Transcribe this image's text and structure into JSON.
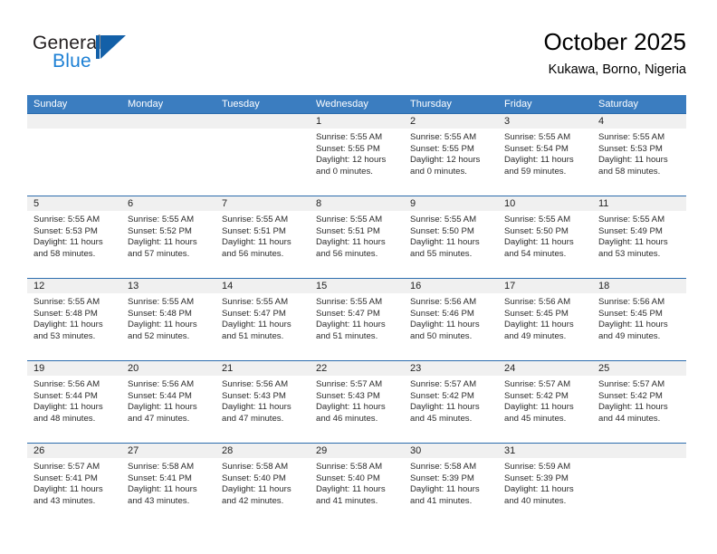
{
  "brand": {
    "name_part1": "General",
    "name_part2": "Blue"
  },
  "header": {
    "title": "October 2025",
    "location": "Kukawa, Borno, Nigeria"
  },
  "calendar": {
    "weekday_headers": [
      "Sunday",
      "Monday",
      "Tuesday",
      "Wednesday",
      "Thursday",
      "Friday",
      "Saturday"
    ],
    "accent_color": "#3b7dc0",
    "separator_color": "#2c6cad",
    "daynum_band_color": "#f0f0f0",
    "weeks": [
      [
        {
          "day": "",
          "sunrise": "",
          "sunset": "",
          "daylight_line1": "",
          "daylight_line2": ""
        },
        {
          "day": "",
          "sunrise": "",
          "sunset": "",
          "daylight_line1": "",
          "daylight_line2": ""
        },
        {
          "day": "",
          "sunrise": "",
          "sunset": "",
          "daylight_line1": "",
          "daylight_line2": ""
        },
        {
          "day": "1",
          "sunrise": "Sunrise: 5:55 AM",
          "sunset": "Sunset: 5:55 PM",
          "daylight_line1": "Daylight: 12 hours",
          "daylight_line2": "and 0 minutes."
        },
        {
          "day": "2",
          "sunrise": "Sunrise: 5:55 AM",
          "sunset": "Sunset: 5:55 PM",
          "daylight_line1": "Daylight: 12 hours",
          "daylight_line2": "and 0 minutes."
        },
        {
          "day": "3",
          "sunrise": "Sunrise: 5:55 AM",
          "sunset": "Sunset: 5:54 PM",
          "daylight_line1": "Daylight: 11 hours",
          "daylight_line2": "and 59 minutes."
        },
        {
          "day": "4",
          "sunrise": "Sunrise: 5:55 AM",
          "sunset": "Sunset: 5:53 PM",
          "daylight_line1": "Daylight: 11 hours",
          "daylight_line2": "and 58 minutes."
        }
      ],
      [
        {
          "day": "5",
          "sunrise": "Sunrise: 5:55 AM",
          "sunset": "Sunset: 5:53 PM",
          "daylight_line1": "Daylight: 11 hours",
          "daylight_line2": "and 58 minutes."
        },
        {
          "day": "6",
          "sunrise": "Sunrise: 5:55 AM",
          "sunset": "Sunset: 5:52 PM",
          "daylight_line1": "Daylight: 11 hours",
          "daylight_line2": "and 57 minutes."
        },
        {
          "day": "7",
          "sunrise": "Sunrise: 5:55 AM",
          "sunset": "Sunset: 5:51 PM",
          "daylight_line1": "Daylight: 11 hours",
          "daylight_line2": "and 56 minutes."
        },
        {
          "day": "8",
          "sunrise": "Sunrise: 5:55 AM",
          "sunset": "Sunset: 5:51 PM",
          "daylight_line1": "Daylight: 11 hours",
          "daylight_line2": "and 56 minutes."
        },
        {
          "day": "9",
          "sunrise": "Sunrise: 5:55 AM",
          "sunset": "Sunset: 5:50 PM",
          "daylight_line1": "Daylight: 11 hours",
          "daylight_line2": "and 55 minutes."
        },
        {
          "day": "10",
          "sunrise": "Sunrise: 5:55 AM",
          "sunset": "Sunset: 5:50 PM",
          "daylight_line1": "Daylight: 11 hours",
          "daylight_line2": "and 54 minutes."
        },
        {
          "day": "11",
          "sunrise": "Sunrise: 5:55 AM",
          "sunset": "Sunset: 5:49 PM",
          "daylight_line1": "Daylight: 11 hours",
          "daylight_line2": "and 53 minutes."
        }
      ],
      [
        {
          "day": "12",
          "sunrise": "Sunrise: 5:55 AM",
          "sunset": "Sunset: 5:48 PM",
          "daylight_line1": "Daylight: 11 hours",
          "daylight_line2": "and 53 minutes."
        },
        {
          "day": "13",
          "sunrise": "Sunrise: 5:55 AM",
          "sunset": "Sunset: 5:48 PM",
          "daylight_line1": "Daylight: 11 hours",
          "daylight_line2": "and 52 minutes."
        },
        {
          "day": "14",
          "sunrise": "Sunrise: 5:55 AM",
          "sunset": "Sunset: 5:47 PM",
          "daylight_line1": "Daylight: 11 hours",
          "daylight_line2": "and 51 minutes."
        },
        {
          "day": "15",
          "sunrise": "Sunrise: 5:55 AM",
          "sunset": "Sunset: 5:47 PM",
          "daylight_line1": "Daylight: 11 hours",
          "daylight_line2": "and 51 minutes."
        },
        {
          "day": "16",
          "sunrise": "Sunrise: 5:56 AM",
          "sunset": "Sunset: 5:46 PM",
          "daylight_line1": "Daylight: 11 hours",
          "daylight_line2": "and 50 minutes."
        },
        {
          "day": "17",
          "sunrise": "Sunrise: 5:56 AM",
          "sunset": "Sunset: 5:45 PM",
          "daylight_line1": "Daylight: 11 hours",
          "daylight_line2": "and 49 minutes."
        },
        {
          "day": "18",
          "sunrise": "Sunrise: 5:56 AM",
          "sunset": "Sunset: 5:45 PM",
          "daylight_line1": "Daylight: 11 hours",
          "daylight_line2": "and 49 minutes."
        }
      ],
      [
        {
          "day": "19",
          "sunrise": "Sunrise: 5:56 AM",
          "sunset": "Sunset: 5:44 PM",
          "daylight_line1": "Daylight: 11 hours",
          "daylight_line2": "and 48 minutes."
        },
        {
          "day": "20",
          "sunrise": "Sunrise: 5:56 AM",
          "sunset": "Sunset: 5:44 PM",
          "daylight_line1": "Daylight: 11 hours",
          "daylight_line2": "and 47 minutes."
        },
        {
          "day": "21",
          "sunrise": "Sunrise: 5:56 AM",
          "sunset": "Sunset: 5:43 PM",
          "daylight_line1": "Daylight: 11 hours",
          "daylight_line2": "and 47 minutes."
        },
        {
          "day": "22",
          "sunrise": "Sunrise: 5:57 AM",
          "sunset": "Sunset: 5:43 PM",
          "daylight_line1": "Daylight: 11 hours",
          "daylight_line2": "and 46 minutes."
        },
        {
          "day": "23",
          "sunrise": "Sunrise: 5:57 AM",
          "sunset": "Sunset: 5:42 PM",
          "daylight_line1": "Daylight: 11 hours",
          "daylight_line2": "and 45 minutes."
        },
        {
          "day": "24",
          "sunrise": "Sunrise: 5:57 AM",
          "sunset": "Sunset: 5:42 PM",
          "daylight_line1": "Daylight: 11 hours",
          "daylight_line2": "and 45 minutes."
        },
        {
          "day": "25",
          "sunrise": "Sunrise: 5:57 AM",
          "sunset": "Sunset: 5:42 PM",
          "daylight_line1": "Daylight: 11 hours",
          "daylight_line2": "and 44 minutes."
        }
      ],
      [
        {
          "day": "26",
          "sunrise": "Sunrise: 5:57 AM",
          "sunset": "Sunset: 5:41 PM",
          "daylight_line1": "Daylight: 11 hours",
          "daylight_line2": "and 43 minutes."
        },
        {
          "day": "27",
          "sunrise": "Sunrise: 5:58 AM",
          "sunset": "Sunset: 5:41 PM",
          "daylight_line1": "Daylight: 11 hours",
          "daylight_line2": "and 43 minutes."
        },
        {
          "day": "28",
          "sunrise": "Sunrise: 5:58 AM",
          "sunset": "Sunset: 5:40 PM",
          "daylight_line1": "Daylight: 11 hours",
          "daylight_line2": "and 42 minutes."
        },
        {
          "day": "29",
          "sunrise": "Sunrise: 5:58 AM",
          "sunset": "Sunset: 5:40 PM",
          "daylight_line1": "Daylight: 11 hours",
          "daylight_line2": "and 41 minutes."
        },
        {
          "day": "30",
          "sunrise": "Sunrise: 5:58 AM",
          "sunset": "Sunset: 5:39 PM",
          "daylight_line1": "Daylight: 11 hours",
          "daylight_line2": "and 41 minutes."
        },
        {
          "day": "31",
          "sunrise": "Sunrise: 5:59 AM",
          "sunset": "Sunset: 5:39 PM",
          "daylight_line1": "Daylight: 11 hours",
          "daylight_line2": "and 40 minutes."
        },
        {
          "day": "",
          "sunrise": "",
          "sunset": "",
          "daylight_line1": "",
          "daylight_line2": ""
        }
      ]
    ]
  }
}
